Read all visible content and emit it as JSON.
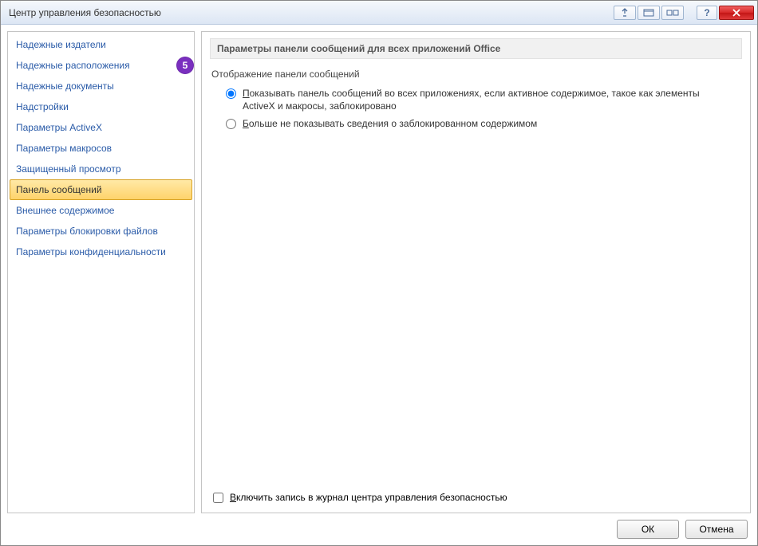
{
  "window": {
    "title": "Центр управления безопасностью"
  },
  "annotation": {
    "badge_number": "5",
    "attached_to_index": 1
  },
  "sidebar": {
    "items": [
      {
        "label": "Надежные издатели"
      },
      {
        "label": "Надежные расположения"
      },
      {
        "label": "Надежные документы"
      },
      {
        "label": "Надстройки"
      },
      {
        "label": "Параметры ActiveX"
      },
      {
        "label": "Параметры макросов"
      },
      {
        "label": "Защищенный просмотр"
      },
      {
        "label": "Панель сообщений"
      },
      {
        "label": "Внешнее содержимое"
      },
      {
        "label": "Параметры блокировки файлов"
      },
      {
        "label": "Параметры конфиденциальности"
      }
    ],
    "selected_index": 7
  },
  "main": {
    "section_heading": "Параметры панели сообщений для всех приложений Office",
    "subheading": "Отображение панели сообщений",
    "radios": [
      {
        "label": "Показывать панель сообщений во всех приложениях, если активное содержимое, такое как элементы ActiveX и макросы, заблокировано",
        "selected": true
      },
      {
        "label": "Больше не показывать сведения о заблокированном содержимом",
        "selected": false
      }
    ],
    "logging_checkbox": {
      "label": "Включить запись в журнал центра управления безопасностью",
      "checked": false
    }
  },
  "footer": {
    "ok_label": "ОК",
    "cancel_label": "Отмена"
  },
  "titlebar_buttons": {
    "help_glyph": "?"
  }
}
